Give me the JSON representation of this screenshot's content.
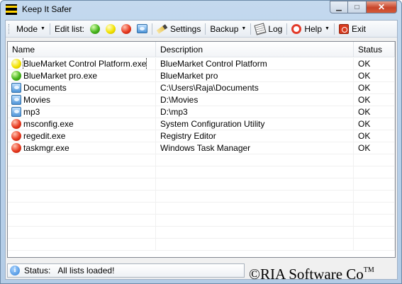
{
  "window": {
    "title": "Keep It Safer"
  },
  "toolbar": {
    "mode_label": "Mode",
    "edit_list_label": "Edit list:",
    "settings_label": "Settings",
    "backup_label": "Backup",
    "log_label": "Log",
    "help_label": "Help",
    "exit_label": "Exit"
  },
  "table": {
    "columns": [
      "Name",
      "Description",
      "Status"
    ],
    "rows": [
      {
        "icon": "yellow-orb-icon",
        "name": "BlueMarket Control Platform.exe",
        "description": "BlueMarket Control Platform",
        "status": "OK",
        "selected": true
      },
      {
        "icon": "green-orb-icon",
        "name": "BlueMarket pro.exe",
        "description": "BlueMarket pro",
        "status": "OK"
      },
      {
        "icon": "folder-icon",
        "name": "Documents",
        "description": "C:\\Users\\Raja\\Documents",
        "status": "OK"
      },
      {
        "icon": "folder-icon",
        "name": "Movies",
        "description": "D:\\Movies",
        "status": "OK"
      },
      {
        "icon": "folder-icon",
        "name": "mp3",
        "description": "D:\\mp3",
        "status": "OK"
      },
      {
        "icon": "red-orb-icon",
        "name": "msconfig.exe",
        "description": "System Configuration Utility",
        "status": "OK"
      },
      {
        "icon": "red-orb-icon",
        "name": "regedit.exe",
        "description": "Registry Editor",
        "status": "OK"
      },
      {
        "icon": "red-orb-icon",
        "name": "taskmgr.exe",
        "description": "Windows Task Manager",
        "status": "OK"
      }
    ]
  },
  "statusbar": {
    "label": "Status:",
    "message": "All lists loaded!",
    "copyright": "©RIA Software Co",
    "trademark": "TM"
  },
  "colors": {
    "green": "#46b51c",
    "yellow": "#f3e400",
    "red": "#e83a20",
    "title_bar": "#b9d1ea"
  }
}
